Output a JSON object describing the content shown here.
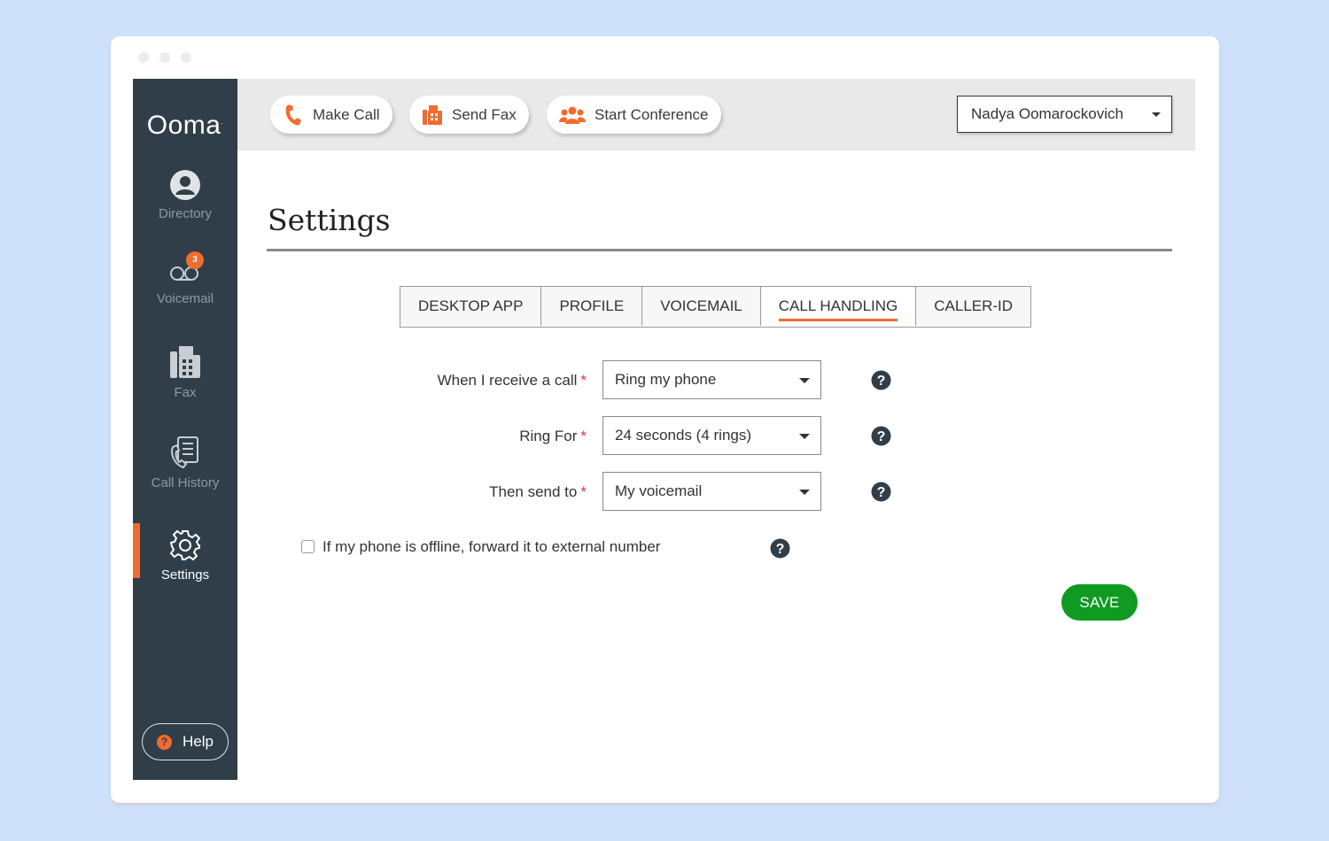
{
  "sidebar": {
    "logo": "Ooma",
    "items": [
      {
        "label": "Directory",
        "icon": "person-icon"
      },
      {
        "label": "Voicemail",
        "icon": "voicemail-icon",
        "badge": "3"
      },
      {
        "label": "Fax",
        "icon": "fax-icon"
      },
      {
        "label": "Call History",
        "icon": "call-history-icon"
      },
      {
        "label": "Settings",
        "icon": "gear-icon",
        "active": true
      }
    ],
    "help_label": "Help"
  },
  "toolbar": {
    "make_call": "Make Call",
    "send_fax": "Send Fax",
    "start_conference": "Start Conference",
    "user_name": "Nadya Oomarockovich"
  },
  "page": {
    "title": "Settings"
  },
  "tabs": [
    {
      "label": "DESKTOP APP",
      "active": false
    },
    {
      "label": "PROFILE",
      "active": false
    },
    {
      "label": "VOICEMAIL",
      "active": false
    },
    {
      "label": "CALL HANDLING",
      "active": true
    },
    {
      "label": "CALLER-ID",
      "active": false
    }
  ],
  "form": {
    "receive_call_label": "When I receive a call",
    "receive_call_value": "Ring my phone",
    "ring_for_label": "Ring For",
    "ring_for_value": "24 seconds (4 rings)",
    "then_send_label": "Then send to",
    "then_send_value": "My voicemail",
    "required_mark": "*",
    "offline_forward_label": "If my phone is offline, forward it to external number",
    "offline_forward_checked": false,
    "save_label": "SAVE"
  },
  "colors": {
    "accent": "#f26b2f",
    "sidebar_bg": "#2f3e48",
    "save_green": "#0f9a22",
    "page_bg": "#cfe0fb"
  }
}
